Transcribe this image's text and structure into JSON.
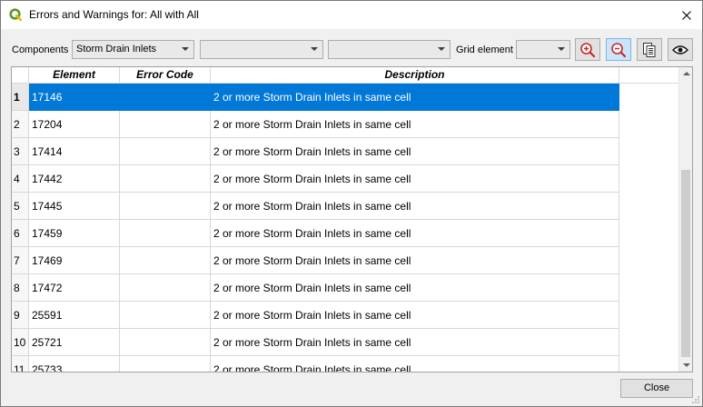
{
  "window": {
    "title": "Errors and Warnings for: All with All"
  },
  "toolbar": {
    "components_label": "Components",
    "components_value": "Storm Drain Inlets",
    "filter2_value": "",
    "filter3_value": "",
    "grid_label": "Grid element",
    "grid_value": ""
  },
  "table": {
    "columns": [
      "Element",
      "Error Code",
      "Description"
    ],
    "rows": [
      {
        "num": "1",
        "element": "17146",
        "code": "",
        "description": "2 or more Storm Drain Inlets in same cell",
        "selected": true
      },
      {
        "num": "2",
        "element": "17204",
        "code": "",
        "description": "2 or more Storm Drain Inlets in same cell"
      },
      {
        "num": "3",
        "element": "17414",
        "code": "",
        "description": "2 or more Storm Drain Inlets in same cell"
      },
      {
        "num": "4",
        "element": "17442",
        "code": "",
        "description": "2 or more Storm Drain Inlets in same cell"
      },
      {
        "num": "5",
        "element": "17445",
        "code": "",
        "description": "2 or more Storm Drain Inlets in same cell"
      },
      {
        "num": "6",
        "element": "17459",
        "code": "",
        "description": "2 or more Storm Drain Inlets in same cell"
      },
      {
        "num": "7",
        "element": "17469",
        "code": "",
        "description": "2 or more Storm Drain Inlets in same cell"
      },
      {
        "num": "8",
        "element": "17472",
        "code": "",
        "description": "2 or more Storm Drain Inlets in same cell"
      },
      {
        "num": "9",
        "element": "25591",
        "code": "",
        "description": "2 or more Storm Drain Inlets in same cell"
      },
      {
        "num": "10",
        "element": "25721",
        "code": "",
        "description": "2 or more Storm Drain Inlets in same cell"
      },
      {
        "num": "11",
        "element": "25733",
        "code": "",
        "description": "2 or more Storm Drain Inlets in same cell"
      }
    ]
  },
  "footer": {
    "close_label": "Close"
  },
  "colors": {
    "selection": "#0078d7",
    "qgis_green": "#589632"
  },
  "icons": [
    "qgis-logo-icon",
    "close-icon",
    "zoom-in-icon",
    "zoom-out-icon",
    "copy-icon",
    "eye-icon"
  ]
}
